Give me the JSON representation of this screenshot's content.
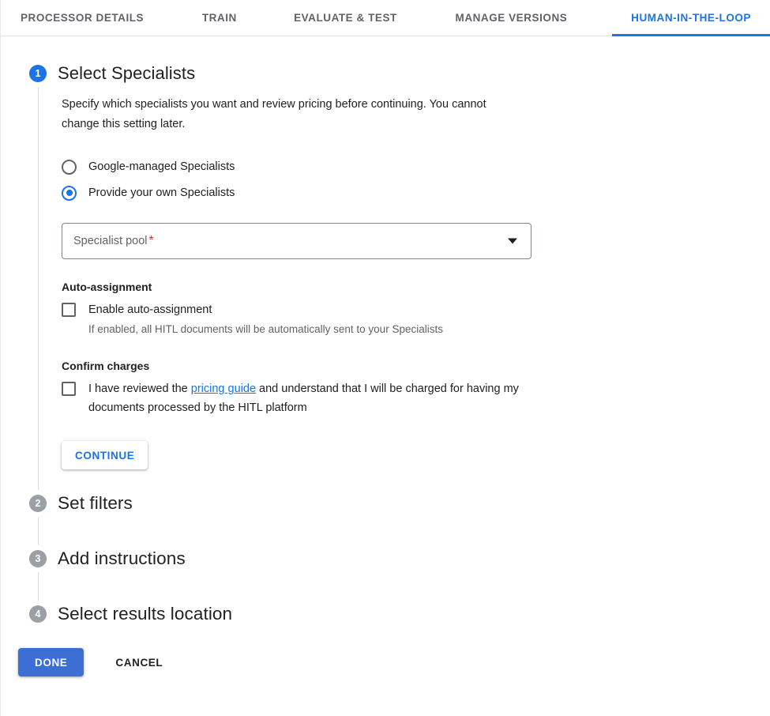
{
  "tabs": [
    {
      "label": "PROCESSOR DETAILS",
      "active": false
    },
    {
      "label": "TRAIN",
      "active": false
    },
    {
      "label": "EVALUATE & TEST",
      "active": false
    },
    {
      "label": "MANAGE VERSIONS",
      "active": false
    },
    {
      "label": "HUMAN-IN-THE-LOOP",
      "active": true
    }
  ],
  "colors": {
    "accent": "#1a73e8",
    "done_button": "#3c6fd3",
    "inactive_step": "#9aa0a6",
    "required_asterisk": "#d93025",
    "text_primary": "#202124",
    "text_secondary": "#5f6368"
  },
  "steps": [
    {
      "number": "1",
      "title": "Select Specialists",
      "description": "Specify which specialists you want and review pricing before continuing. You cannot change this setting later.",
      "radios": [
        {
          "label": "Google-managed Specialists",
          "checked": false
        },
        {
          "label": "Provide your own Specialists",
          "checked": true
        }
      ],
      "select": {
        "label": "Specialist pool",
        "required_marker": "*",
        "value": "",
        "placeholder": "Specialist pool",
        "caret_icon": "chevron-down-icon"
      },
      "auto_assignment": {
        "heading": "Auto-assignment",
        "checkbox_label": "Enable auto-assignment",
        "checked": false,
        "hint": "If enabled, all HITL documents will be automatically sent to your Specialists"
      },
      "confirm_charges": {
        "heading": "Confirm charges",
        "checked": false,
        "text_before": "I have reviewed the",
        "link_text": "pricing guide",
        "text_after": "and understand that I will be charged for having my documents processed by the HITL platform"
      },
      "continue_label": "CONTINUE"
    },
    {
      "number": "2",
      "title": "Set filters"
    },
    {
      "number": "3",
      "title": "Add instructions"
    },
    {
      "number": "4",
      "title": "Select results location"
    }
  ],
  "footer": {
    "done_label": "DONE",
    "cancel_label": "CANCEL"
  }
}
